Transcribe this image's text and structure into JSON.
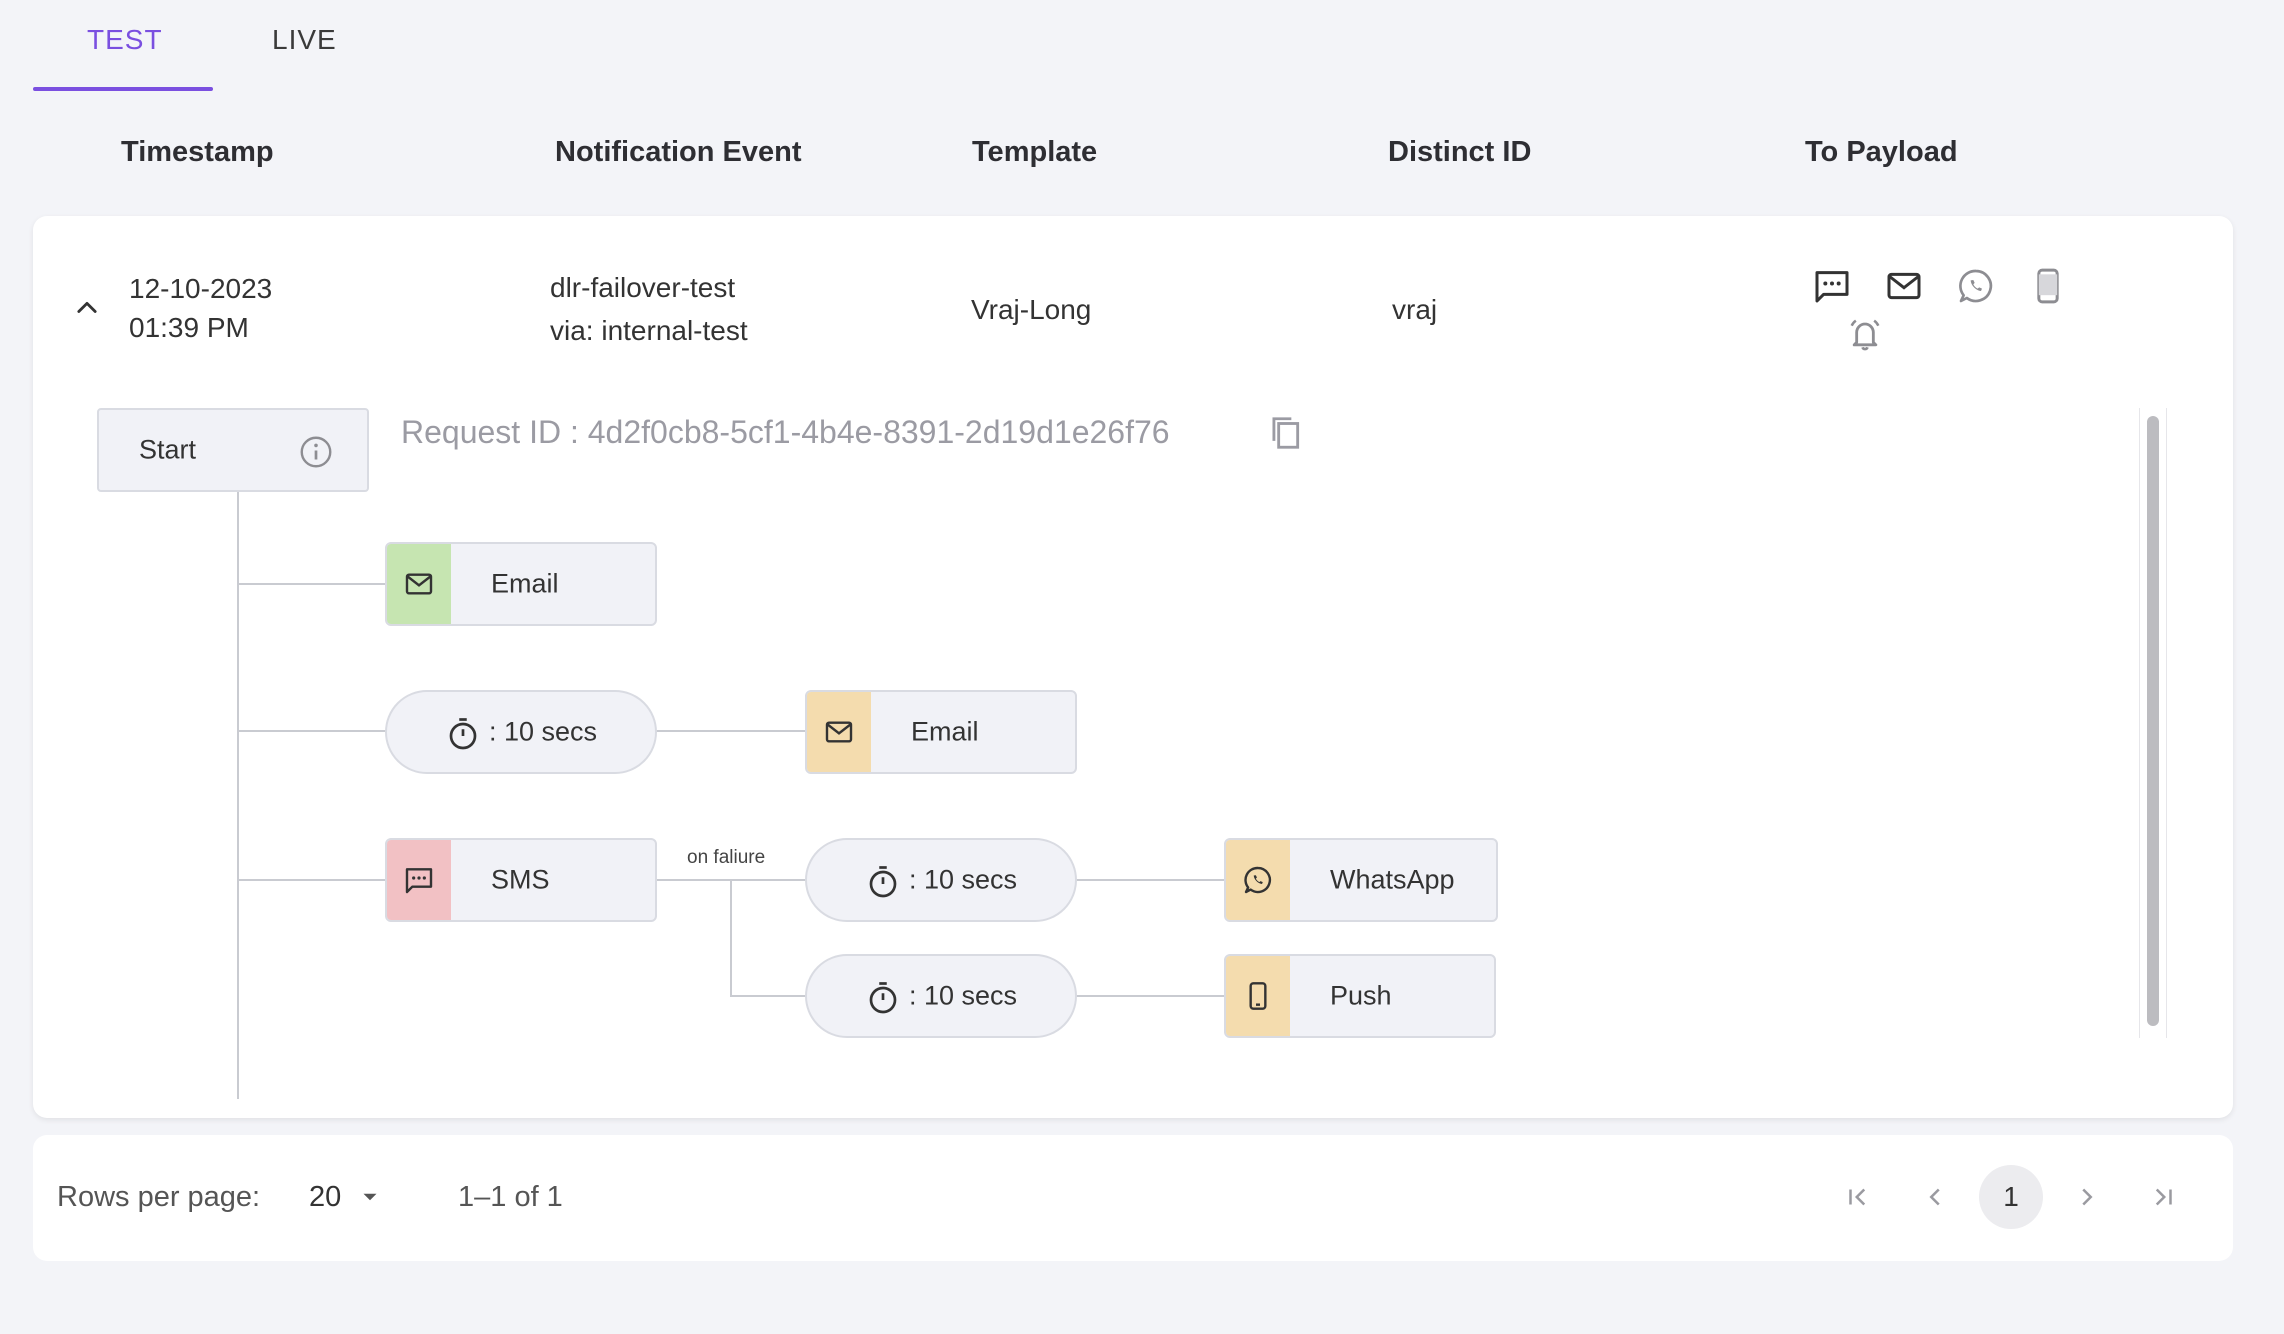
{
  "tabs": [
    {
      "label": "TEST"
    },
    {
      "label": "LIVE"
    }
  ],
  "columns": [
    "Timestamp",
    "Notification Event",
    "Template",
    "Distinct ID",
    "To Payload"
  ],
  "row": {
    "date": "12-10-2023",
    "time": "01:39 PM",
    "event": "dlr-failover-test",
    "via": "via: internal-test",
    "template": "Vraj-Long",
    "distinct_id": "vraj",
    "payload_icons": [
      "sms-icon",
      "email-icon",
      "whatsapp-icon",
      "mobile-push-icon",
      "inbox-bell-icon"
    ]
  },
  "flow": {
    "start_label": "Start",
    "request_id": "Request ID : 4d2f0cb8-5cf1-4b4e-8391-2d19d1e26f76",
    "email1_label": "Email",
    "delay1_label": ": 10 secs",
    "email2_label": "Email",
    "sms_label": "SMS",
    "on_failure_label": "on faliure",
    "delay2_label": ": 10 secs",
    "whatsapp_label": "WhatsApp",
    "delay3_label": ": 10 secs",
    "push_label": "Push",
    "colors": {
      "email_success": "#c6e5b1",
      "email_pending": "#f4dcae",
      "sms_failed": "#f2c1c4",
      "whatsapp_pending": "#f4dcae",
      "push_pending": "#f4dcae"
    }
  },
  "pagination": {
    "rows_per_page_label": "Rows per page:",
    "rows_per_page": "20",
    "range": "1–1 of 1",
    "current_page": "1"
  }
}
